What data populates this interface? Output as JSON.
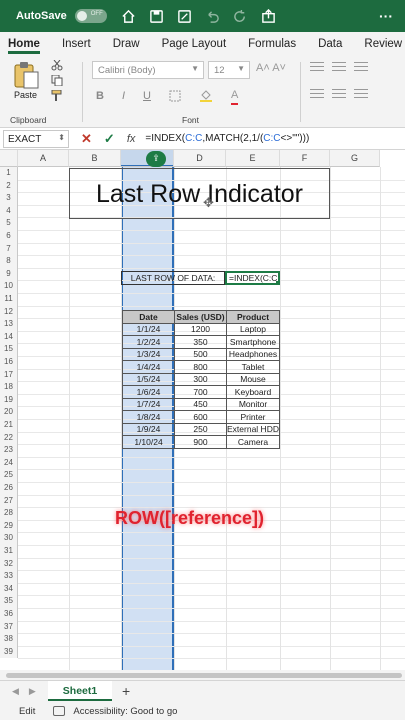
{
  "titlebar": {
    "autosave_label": "AutoSave",
    "toggle_state": "OFF",
    "more": "···"
  },
  "tabs": [
    "Home",
    "Insert",
    "Draw",
    "Page Layout",
    "Formulas",
    "Data",
    "Review",
    "Vi"
  ],
  "ribbon": {
    "paste_label": "Paste",
    "clipboard_label": "Clipboard",
    "font_name": "Calibri (Body)",
    "font_size": "12",
    "bold": "B",
    "italic": "I",
    "underline": "U",
    "font_label": "Font",
    "grow": "A˄ A˅",
    "font_color": "A"
  },
  "formula_bar": {
    "name_box": "EXACT",
    "cancel": "✕",
    "enter": "✓",
    "fx": "fx",
    "formula_prefix": "=INDEX(",
    "formula_ref1": "C:C",
    "formula_mid": ",MATCH(2,1/(",
    "formula_ref2": "C:C",
    "formula_suffix": "<>\"\")))"
  },
  "grid": {
    "columns": [
      "A",
      "B",
      "C",
      "D",
      "E",
      "F",
      "G"
    ],
    "rows": [
      "1",
      "2",
      "3",
      "4",
      "5",
      "6",
      "7",
      "8",
      "9",
      "10",
      "11",
      "12",
      "13",
      "14",
      "15",
      "16",
      "17",
      "18",
      "19",
      "20",
      "21",
      "22",
      "23",
      "24",
      "25",
      "26",
      "27",
      "28",
      "29",
      "30",
      "31",
      "32",
      "33",
      "34",
      "35",
      "36",
      "37",
      "38",
      "39"
    ],
    "title": "Last Row Indicator",
    "last_row_label": "LAST ROW OF DATA:",
    "active_cell_text": "=INDEX(C:C,",
    "table": {
      "headers": [
        "Date",
        "Sales (USD)",
        "Product"
      ],
      "rows": [
        [
          "1/1/24",
          "1200",
          "Laptop"
        ],
        [
          "1/2/24",
          "350",
          "Smartphone"
        ],
        [
          "1/3/24",
          "500",
          "Headphones"
        ],
        [
          "1/4/24",
          "800",
          "Tablet"
        ],
        [
          "1/5/24",
          "300",
          "Mouse"
        ],
        [
          "1/6/24",
          "700",
          "Keyboard"
        ],
        [
          "1/7/24",
          "450",
          "Monitor"
        ],
        [
          "1/8/24",
          "600",
          "Printer"
        ],
        [
          "1/9/24",
          "250",
          "External HDD"
        ],
        [
          "1/10/24",
          "900",
          "Camera"
        ]
      ]
    },
    "overlay_text": "ROW([reference])"
  },
  "sheets": {
    "active": "Sheet1",
    "add": "+"
  },
  "status": {
    "mode": "Edit",
    "accessibility": "Accessibility: Good to go"
  },
  "colors": {
    "brand": "#1d6b3f",
    "selection": "#2f6fb8",
    "overlay": "#e0232f"
  }
}
